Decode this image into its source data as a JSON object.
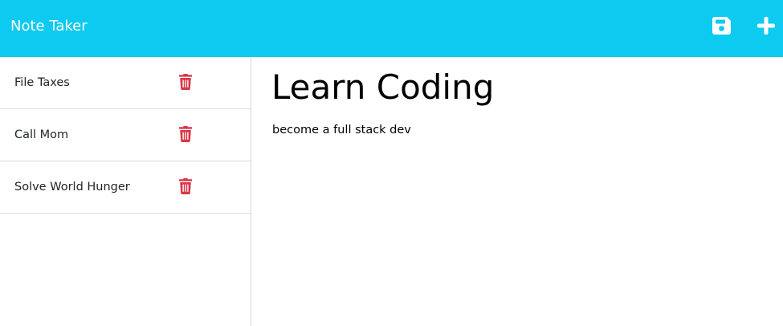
{
  "app": {
    "title": "Note Taker"
  },
  "toolbar": {
    "save_icon": "floppy-disk-icon",
    "new_icon": "plus-icon"
  },
  "colors": {
    "navbar_bg": "#0dcaf0",
    "delete": "#dc3545",
    "brand_text": "#ffffff"
  },
  "notes": [
    {
      "title": "File Taxes",
      "delete_icon": "trash-icon"
    },
    {
      "title": "Call Mom",
      "delete_icon": "trash-icon"
    },
    {
      "title": "Solve World Hunger",
      "delete_icon": "trash-icon"
    }
  ],
  "active_note": {
    "title": "Learn Coding",
    "text": "become a full stack dev"
  }
}
